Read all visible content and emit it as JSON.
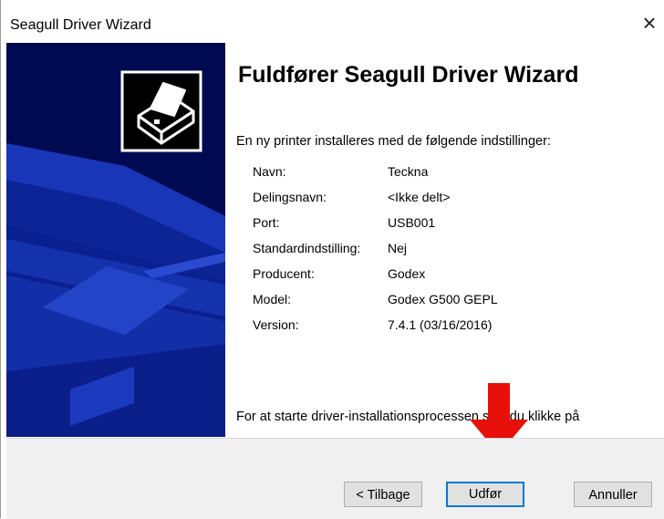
{
  "window": {
    "title": "Seagull Driver Wizard",
    "close_glyph": "×"
  },
  "main": {
    "heading": "Fuldfører Seagull Driver Wizard",
    "intro": "En ny printer installeres med de følgende indstillinger:",
    "settings": [
      {
        "label": "Navn:",
        "value": "Teckna"
      },
      {
        "label": "Delingsnavn:",
        "value": "<Ikke delt>"
      },
      {
        "label": "Port:",
        "value": "USB001"
      },
      {
        "label": "Standardindstilling:",
        "value": "Nej"
      },
      {
        "label": "Producent:",
        "value": "Godex"
      },
      {
        "label": "Model:",
        "value": "Godex G500 GEPL"
      },
      {
        "label": "Version:",
        "value": "7.4.1 (03/16/2016)"
      }
    ],
    "footer_text": "For at starte driver-installationsprocessen skal du klikke på"
  },
  "buttons": {
    "back": "< Tilbage",
    "finish": "Udfør",
    "cancel": "Annuller"
  },
  "colors": {
    "sidebar": "#000a52",
    "accent_arrow": "#e8100a",
    "default_button_border": "#0078d7"
  },
  "icons": {
    "logo": "printer-logo-icon",
    "annotation": "red-down-arrow"
  }
}
